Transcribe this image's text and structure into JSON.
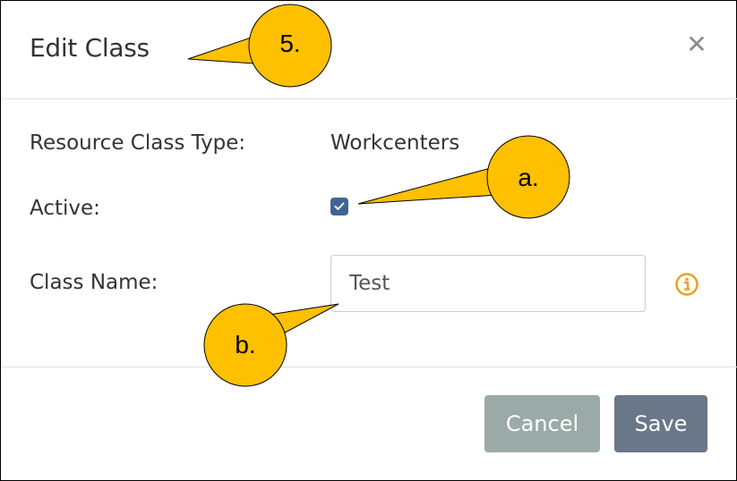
{
  "dialog": {
    "title": "Edit Class",
    "close_symbol": "✕",
    "fields": {
      "resource_class_type_label": "Resource Class Type:",
      "resource_class_type_value": "Workcenters",
      "active_label": "Active:",
      "active_checked": true,
      "class_name_label": "Class Name:",
      "class_name_value": "Test"
    },
    "buttons": {
      "cancel_label": "Cancel",
      "save_label": "Save"
    }
  },
  "callouts": {
    "c5": "5.",
    "ca": "a.",
    "cb": "b."
  },
  "colors": {
    "checkbox": "#3f6494",
    "info_icon": "#f0a01e",
    "cancel_button": "#9aaaa7",
    "save_button": "#6a7789",
    "callout_fill": "#ffc000"
  },
  "icons": {
    "close": "close-icon",
    "check": "check-icon",
    "info": "info-icon"
  }
}
